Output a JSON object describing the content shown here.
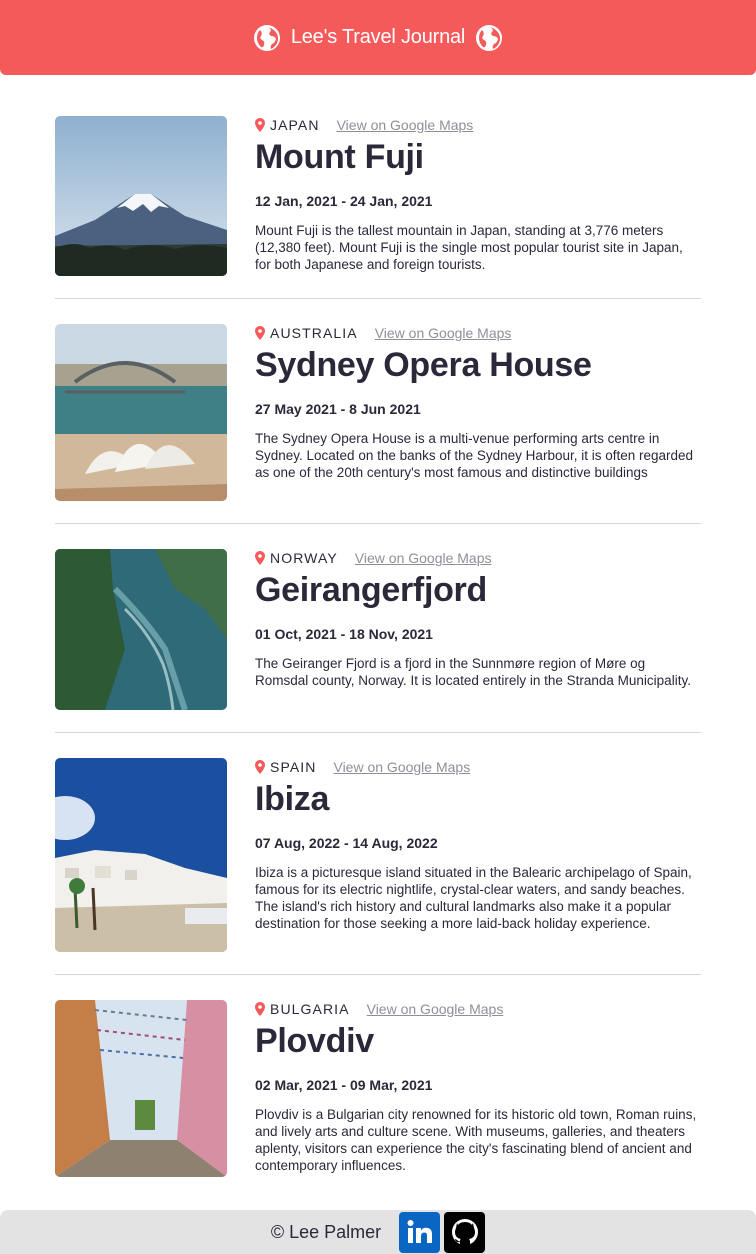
{
  "header": {
    "title": "Lee's Travel Journal",
    "icon": "globe-icon",
    "bg_color": "#f55a5a"
  },
  "entries": [
    {
      "country": "JAPAN",
      "map_link": "View on Google Maps",
      "place": "Mount Fuji",
      "dates": "12 Jan, 2021 - 24 Jan, 2021",
      "description": "Mount Fuji is the tallest mountain in Japan, standing at 3,776 meters (12,380 feet). Mount Fuji is the single most popular tourist site in Japan, for both Japanese and foreign tourists."
    },
    {
      "country": "AUSTRALIA",
      "map_link": "View on Google Maps",
      "place": "Sydney Opera House",
      "dates": "27 May 2021 - 8 Jun 2021",
      "description": "The Sydney Opera House is a multi-venue performing arts centre in Sydney. Located on the banks of the Sydney Harbour, it is often regarded as one of the 20th century's most famous and distinctive buildings"
    },
    {
      "country": "NORWAY",
      "map_link": "View on Google Maps",
      "place": "Geirangerfjord",
      "dates": "01 Oct, 2021 - 18 Nov, 2021",
      "description": "The Geiranger Fjord is a fjord in the Sunnmøre region of Møre og Romsdal county, Norway. It is located entirely in the Stranda Municipality."
    },
    {
      "country": "SPAIN",
      "map_link": "View on Google Maps",
      "place": "Ibiza",
      "dates": "07 Aug, 2022 - 14 Aug, 2022",
      "description": "Ibiza is a picturesque island situated in the Balearic archipelago of Spain, famous for its electric nightlife, crystal-clear waters, and sandy beaches. The island's rich history and cultural landmarks also make it a popular destination for those seeking a more laid-back holiday experience."
    },
    {
      "country": "BULGARIA",
      "map_link": "View on Google Maps",
      "place": "Plovdiv",
      "dates": "02 Mar, 2021 - 09 Mar, 2021",
      "description": "Plovdiv is a Bulgarian city renowned for its historic old town, Roman ruins, and lively arts and culture scene. With museums, galleries, and theaters aplenty, visitors can experience the city's fascinating blend of ancient and contemporary influences."
    }
  ],
  "footer": {
    "copyright": "© Lee Palmer",
    "links": [
      {
        "icon": "linkedin-icon",
        "color": "#0a66c2"
      },
      {
        "icon": "github-icon",
        "color": "#000000"
      }
    ]
  },
  "colors": {
    "accent": "#f55a5a",
    "link": "#918e9b",
    "text": "#2b283a",
    "divider": "#d6d6d6"
  }
}
